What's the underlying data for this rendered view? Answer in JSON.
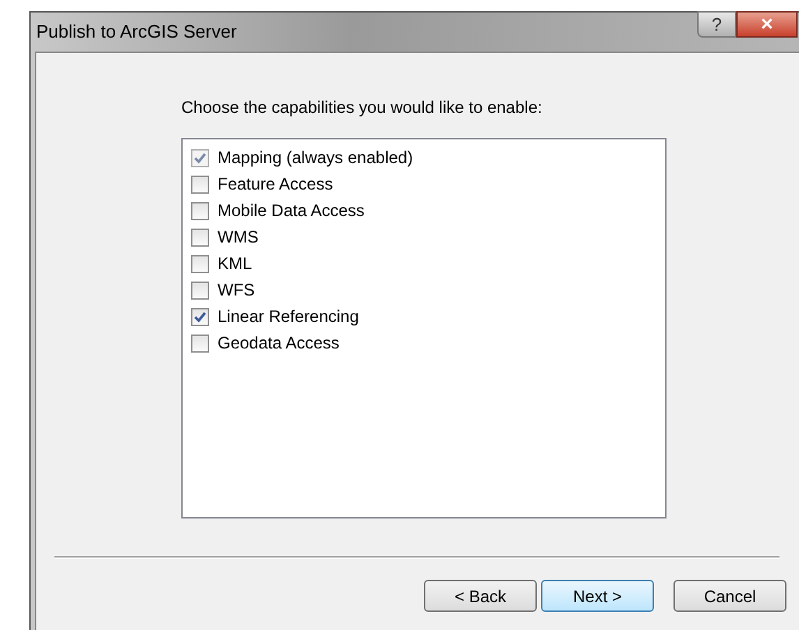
{
  "window": {
    "title": "Publish to ArcGIS Server",
    "help_glyph": "?",
    "close_glyph": "×"
  },
  "prompt": "Choose the capabilities you would like to enable:",
  "capabilities": [
    {
      "label": "Mapping (always enabled)",
      "checked": true,
      "disabled": true
    },
    {
      "label": "Feature Access",
      "checked": false,
      "disabled": false
    },
    {
      "label": "Mobile Data Access",
      "checked": false,
      "disabled": false
    },
    {
      "label": "WMS",
      "checked": false,
      "disabled": false
    },
    {
      "label": "KML",
      "checked": false,
      "disabled": false
    },
    {
      "label": "WFS",
      "checked": false,
      "disabled": false
    },
    {
      "label": "Linear Referencing",
      "checked": true,
      "disabled": false
    },
    {
      "label": "Geodata Access",
      "checked": false,
      "disabled": false
    }
  ],
  "buttons": [
    {
      "label": "< Back",
      "default": false
    },
    {
      "label": "Next >",
      "default": true
    },
    {
      "label": "Cancel",
      "default": false
    }
  ]
}
